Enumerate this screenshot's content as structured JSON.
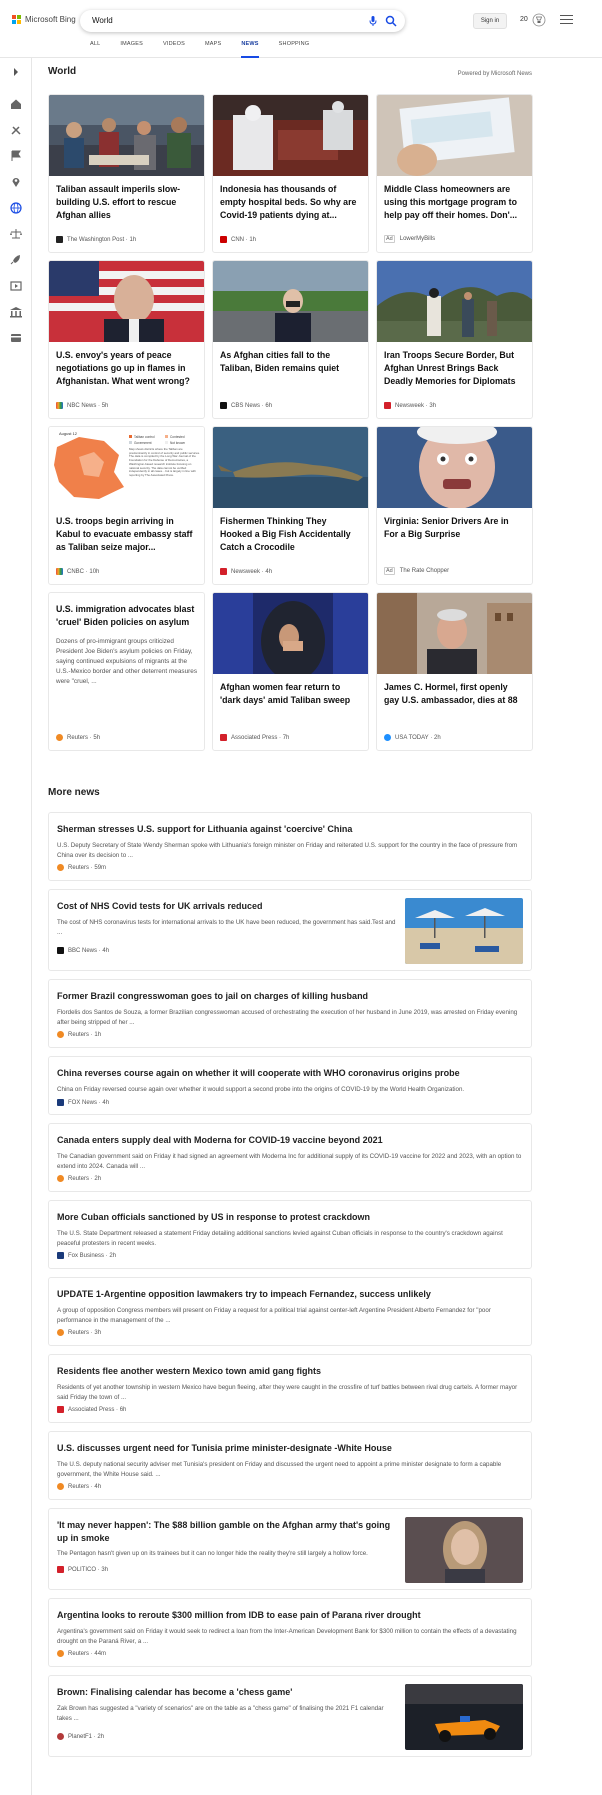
{
  "header": {
    "brand": "Microsoft Bing",
    "brand_colors": [
      "#f25022",
      "#7fba00",
      "#00a4ef",
      "#ffb900"
    ],
    "search_value": "World",
    "signin_label": "Sign in",
    "points": "20",
    "accent": "#174ae4"
  },
  "nav": {
    "items": [
      {
        "label": "ALL"
      },
      {
        "label": "IMAGES"
      },
      {
        "label": "VIDEOS"
      },
      {
        "label": "MAPS"
      },
      {
        "label": "NEWS"
      },
      {
        "label": "SHOPPING"
      }
    ],
    "active": "NEWS"
  },
  "sidebar": {
    "icons": [
      "chevron-right-icon",
      "home-icon",
      "tools-icon",
      "flag-icon",
      "map-pin-icon",
      "globe-icon",
      "scale-icon",
      "rocket-icon",
      "film-icon",
      "bank-icon",
      "wallet-icon"
    ]
  },
  "world": {
    "title": "World",
    "powered_by": "Powered by Microsoft News",
    "cards": [
      {
        "title": "Taliban assault imperils slow-building U.S. effort to rescue Afghan allies",
        "source": "The Washington Post",
        "time": "1h",
        "icon": "wapo-icon"
      },
      {
        "title": "Indonesia has thousands of empty hospital beds. So why are Covid-19 patients dying at...",
        "source": "CNN",
        "time": "1h",
        "icon": "cnn-icon"
      },
      {
        "title": "Middle Class homeowners are using this mortgage program to help pay off their homes. Don'...",
        "source": "LowerMyBills",
        "ad": "Ad",
        "icon": ""
      },
      {
        "title": "U.S. envoy's years of peace negotiations go up in flames in Afghanistan. What went wrong?",
        "source": "NBC News",
        "time": "5h",
        "icon": "nbc-icon"
      },
      {
        "title": "As Afghan cities fall to the Taliban, Biden remains quiet",
        "source": "CBS News",
        "time": "6h",
        "icon": "cbs-icon"
      },
      {
        "title": "Iran Troops Secure Border, But Afghan Unrest Brings Back Deadly Memories for Diplomats",
        "source": "Newsweek",
        "time": "3h",
        "icon": "newsweek-icon"
      },
      {
        "title": "U.S. troops begin arriving in Kabul to evacuate embassy staff as Taliban seize major...",
        "source": "CNBC",
        "time": "10h",
        "icon": "cnbc-icon"
      },
      {
        "title": "Fishermen Thinking They Hooked a Big Fish Accidentally Catch a Crocodile",
        "source": "Newsweek",
        "time": "4h",
        "icon": "newsweek-icon"
      },
      {
        "title": "Virginia: Senior Drivers Are in For a Big Surprise",
        "source": "The Rate Chopper",
        "ad": "Ad",
        "icon": ""
      },
      {
        "title": "U.S. immigration advocates blast 'cruel' Biden policies on asylum",
        "desc": "Dozens of pro-immigrant groups criticized President Joe Biden's asylum policies on Friday, saying continued expulsions of migrants at the U.S.-Mexico border and other deterrent measures were \"cruel, ...",
        "source": "Reuters",
        "time": "5h",
        "icon": "reuters-icon"
      },
      {
        "title": "Afghan women fear return to 'dark days' amid Taliban sweep",
        "source": "Associated Press",
        "time": "7h",
        "icon": "ap-icon"
      },
      {
        "title": "James C. Hormel, first openly gay U.S. ambassador, dies at 88",
        "source": "USA TODAY",
        "time": "2h",
        "icon": "usatoday-icon"
      }
    ],
    "map_card": {
      "date": "August 12",
      "legend": [
        "Taliban control",
        "Contested",
        "Government",
        "Not known"
      ],
      "note": "Map shows districts where the Taliban are predominantly in control of security and public services. The data is compiled by the Long War Journal of the Foundation for the Defense of Democracies, a Washington-based research institute focusing on national security. The data cannot be verified independently in all cases... but is largely in line with reporting by The Associated Press."
    }
  },
  "more_news": {
    "title": "More news",
    "items": [
      {
        "title": "Sherman stresses U.S. support for Lithuania against 'coercive' China",
        "desc": "U.S. Deputy Secretary of State Wendy Sherman spoke with Lithuania's foreign minister on Friday and reiterated U.S. support for the country in the face of pressure from China over its decision to ...",
        "source": "Reuters",
        "time": "59m",
        "icon": "reuters-icon"
      },
      {
        "title": "Cost of NHS Covid tests for UK arrivals reduced",
        "desc": "The cost of NHS coronavirus tests for international arrivals to the UK have been reduced, the government has said.Test and ...",
        "source": "BBC News",
        "time": "4h",
        "icon": "bbc-icon"
      },
      {
        "title": "Former Brazil congresswoman goes to jail on charges of killing husband",
        "desc": "Flordelis dos Santos de Souza, a former Brazilian congresswoman accused of orchestrating the execution of her husband in June 2019, was arrested on Friday evening after being stripped of her ...",
        "source": "Reuters",
        "time": "1h",
        "icon": "reuters-icon"
      },
      {
        "title": "China reverses course again on whether it will cooperate with WHO coronavirus origins probe",
        "desc": "China on Friday reversed course again over whether it would support a second probe into the origins of COVID-19 by the World Health Organization.",
        "source": "FOX News",
        "time": "4h",
        "icon": "fox-icon"
      },
      {
        "title": "Canada enters supply deal with Moderna for COVID-19 vaccine beyond 2021",
        "desc": "The Canadian government said on Friday it had signed an agreement with Moderna Inc for additional supply of its COVID-19 vaccine for 2022 and 2023, with an option to extend into 2024. Canada will ...",
        "source": "Reuters",
        "time": "2h",
        "icon": "reuters-icon"
      },
      {
        "title": "More Cuban officials sanctioned by US in response to protest crackdown",
        "desc": "The U.S. State Department released a statement Friday detailing additional sanctions levied against Cuban officials in response to the country's crackdown against peaceful protesters in recent weeks.",
        "source": "Fox Business",
        "time": "2h",
        "icon": "foxbiz-icon"
      },
      {
        "title": "UPDATE 1-Argentine opposition lawmakers try to impeach Fernandez, success unlikely",
        "desc": "A group of opposition Congress members will present on Friday a request for a political trial against center-left Argentine President Alberto Fernandez for \"poor performance in the management of the ...",
        "source": "Reuters",
        "time": "3h",
        "icon": "reuters-icon"
      },
      {
        "title": "Residents flee another western Mexico town amid gang fights",
        "desc": "Residents of yet another township in western Mexico have begun fleeing, after they were caught in the crossfire of turf battles between rival drug cartels. A former mayor said Friday the town of ...",
        "source": "Associated Press",
        "time": "6h",
        "icon": "ap-icon"
      },
      {
        "title": "U.S. discusses urgent need for Tunisia prime minister-designate -White House",
        "desc": "The U.S. deputy national security adviser met Tunisia's president on Friday and discussed the urgent need to appoint a prime minister designate to form a capable government, the White House said. ...",
        "source": "Reuters",
        "time": "4h",
        "icon": "reuters-icon"
      },
      {
        "title": "'It may never happen': The $88 billion gamble on the Afghan army that's going up in smoke",
        "desc": "The Pentagon hasn't given up on its trainees but it can no longer hide the reality they're still largely a hollow force.",
        "source": "POLITICO",
        "time": "3h",
        "icon": "politico-icon"
      },
      {
        "title": "Argentina looks to reroute $300 million from IDB to ease pain of Parana river drought",
        "desc": "Argentina's government said on Friday it would seek to redirect a loan from the Inter-American Development Bank for $300 million to contain the effects of a devastating drought on the Paraná River, a ...",
        "source": "Reuters",
        "time": "44m",
        "icon": "reuters-icon"
      },
      {
        "title": "Brown: Finalising calendar has become a 'chess game'",
        "desc": "Zak Brown has suggested a \"variety of scenarios\" are on the table as a \"chess game\" of finalising the 2021 F1 calendar takes ...",
        "source": "PlanetF1",
        "time": "2h",
        "icon": "planetf1-icon"
      }
    ]
  }
}
